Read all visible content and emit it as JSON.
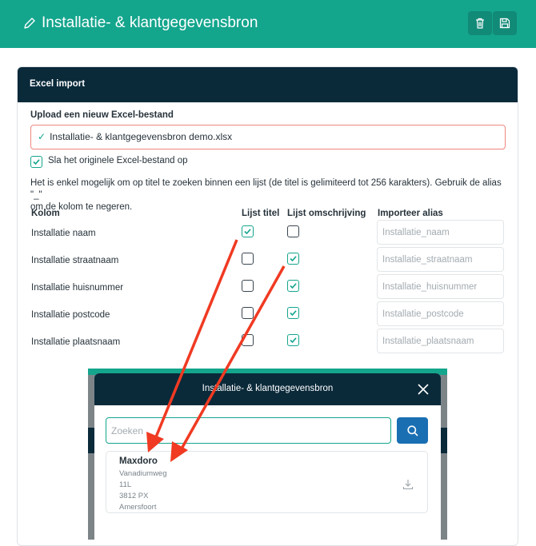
{
  "header": {
    "title": "Installatie- & klantgegevensbron"
  },
  "card": {
    "title": "Excel import",
    "upload_label": "Upload een nieuw Excel-bestand",
    "file_name": "Installatie- & klantgegevensbron demo.xlsx",
    "keep_label": "Sla het originele Excel-bestand op",
    "keep_checked": true,
    "info_line1": "Het is enkel mogelijk om op titel te zoeken binnen een lijst (de titel is gelimiteerd tot 256 karakters). Gebruik de alias \"_\"",
    "info_line2": "om de kolom te negeren.",
    "columns": {
      "kolom": "Kolom",
      "lijst_titel": "Lijst titel",
      "lijst_omschrijving": "Lijst omschrijving",
      "alias": "Importeer alias"
    },
    "rows": [
      {
        "name": "Installatie naam",
        "titel": true,
        "omschrijving": false,
        "alias": "Installatie_naam"
      },
      {
        "name": "Installatie straatnaam",
        "titel": false,
        "omschrijving": true,
        "alias": "Installatie_straatnaam"
      },
      {
        "name": "Installatie huisnummer",
        "titel": false,
        "omschrijving": true,
        "alias": "Installatie_huisnummer"
      },
      {
        "name": "Installatie postcode",
        "titel": false,
        "omschrijving": true,
        "alias": "Installatie_postcode"
      },
      {
        "name": "Installatie plaatsnaam",
        "titel": false,
        "omschrijving": true,
        "alias": "Installatie_plaatsnaam"
      }
    ]
  },
  "modal": {
    "title": "Installatie- & klantgegevensbron",
    "search_placeholder": "Zoeken",
    "result": {
      "name": "Maxdoro",
      "street": "Vanadiumweg",
      "number": "11L",
      "postcode": "3812 PX",
      "city": "Amersfoort"
    }
  },
  "colors": {
    "teal": "#14a58d",
    "navy": "#0a2a3a",
    "blue": "#1a6fb3",
    "arrow": "#f03a22"
  }
}
